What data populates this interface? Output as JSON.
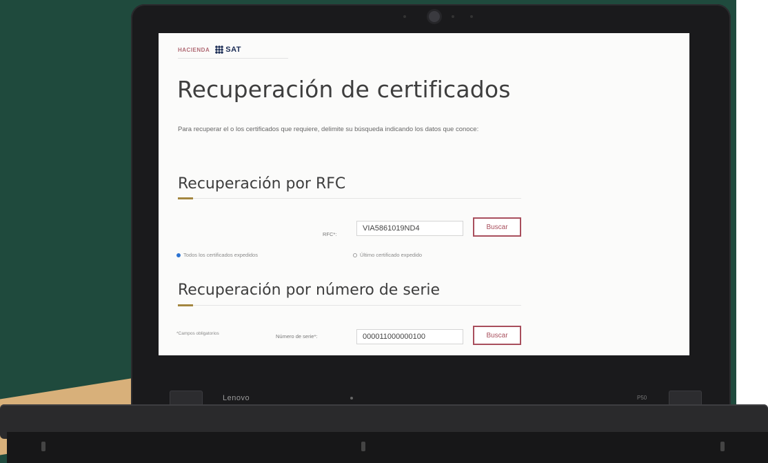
{
  "header": {
    "hacienda_logo_text": "HACIENDA",
    "sat_logo_text": "SAT"
  },
  "page": {
    "title": "Recuperación de certificados",
    "intro": "Para recuperar el o los certificados que requiere, delimite su búsqueda indicando los datos que conoce:"
  },
  "rfc_section": {
    "title": "Recuperación por RFC",
    "field_label": "RFC*:",
    "field_value": "VIA5861019ND4",
    "button_label": "Buscar",
    "radio_all_label": "Todos los certificados expedidos",
    "radio_last_label": "Último certificado expedido",
    "selected_option": "all"
  },
  "serial_section": {
    "title": "Recuperación por número de serie",
    "required_note": "*Campos obligatorios",
    "field_label": "Número de serie*:",
    "field_value": "000011000000100",
    "button_label": "Buscar"
  },
  "laptop": {
    "brand": "Lenovo",
    "model": "P50"
  },
  "colors": {
    "background_green": "#1f4a3d",
    "accent_gold": "#a3863f",
    "button_border": "#a84e5c",
    "radio_selected": "#2c73d2"
  }
}
